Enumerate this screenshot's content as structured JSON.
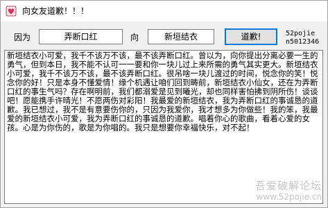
{
  "window": {
    "title": "向女友道歉！！！"
  },
  "form": {
    "reason_label": "因为",
    "reason_value": "弄断口红",
    "to_label": "向",
    "name_value": "新垣结衣",
    "apologize_button": "道歉!"
  },
  "credit": {
    "line1": "52pojie",
    "line2": "n5012346"
  },
  "letter": {
    "body": "新垣结衣小可爱，我千不该万不该，最不该弄断口红。曾以为，向你提出分离必要一生的勇气，但到本日，我不能不认可一一要和你一块儿过上来所需的勇气其实更大。新垣结衣小可爱，我千不该万不该，最不该弄断口红。很吊啥一块儿渡过的时间，悦念你的笑！悦念你的好！只是本身不懂爱情！缘个机遇让咱们回到畴前，新垣结衣小仙女，还在为弄断口红的事生气吗？存在啊明前，我们都溺爱是见到曦光，却也同样害怕拂到阴所伤！谈谈吧！愿能携手许晴光！不愿两伤对彩阳！我最爱的新垣结衣，我为弄断口红的事诚恳的道歉。我已想过，我不是有意要伤你的，只因为我爱你，我才想多为你做些！我的笨，我最爱的新垣结衣小可爱，我为弄断口红的事诚恳的道歉。唱着你心的歌曲，看着心爱的女孩。心是为你伤的，歌是为你唱的。我只是想要你幸福快乐，对不起！"
  },
  "watermark": {
    "line1": "吾爱破解论坛",
    "line2": "www.52pojie.cn"
  },
  "colors": {
    "accent": "#0078d7",
    "window_bg": "#f0f0f0",
    "field_border": "#7a7a7a"
  },
  "icons": {
    "app": "heart-app-icon"
  }
}
